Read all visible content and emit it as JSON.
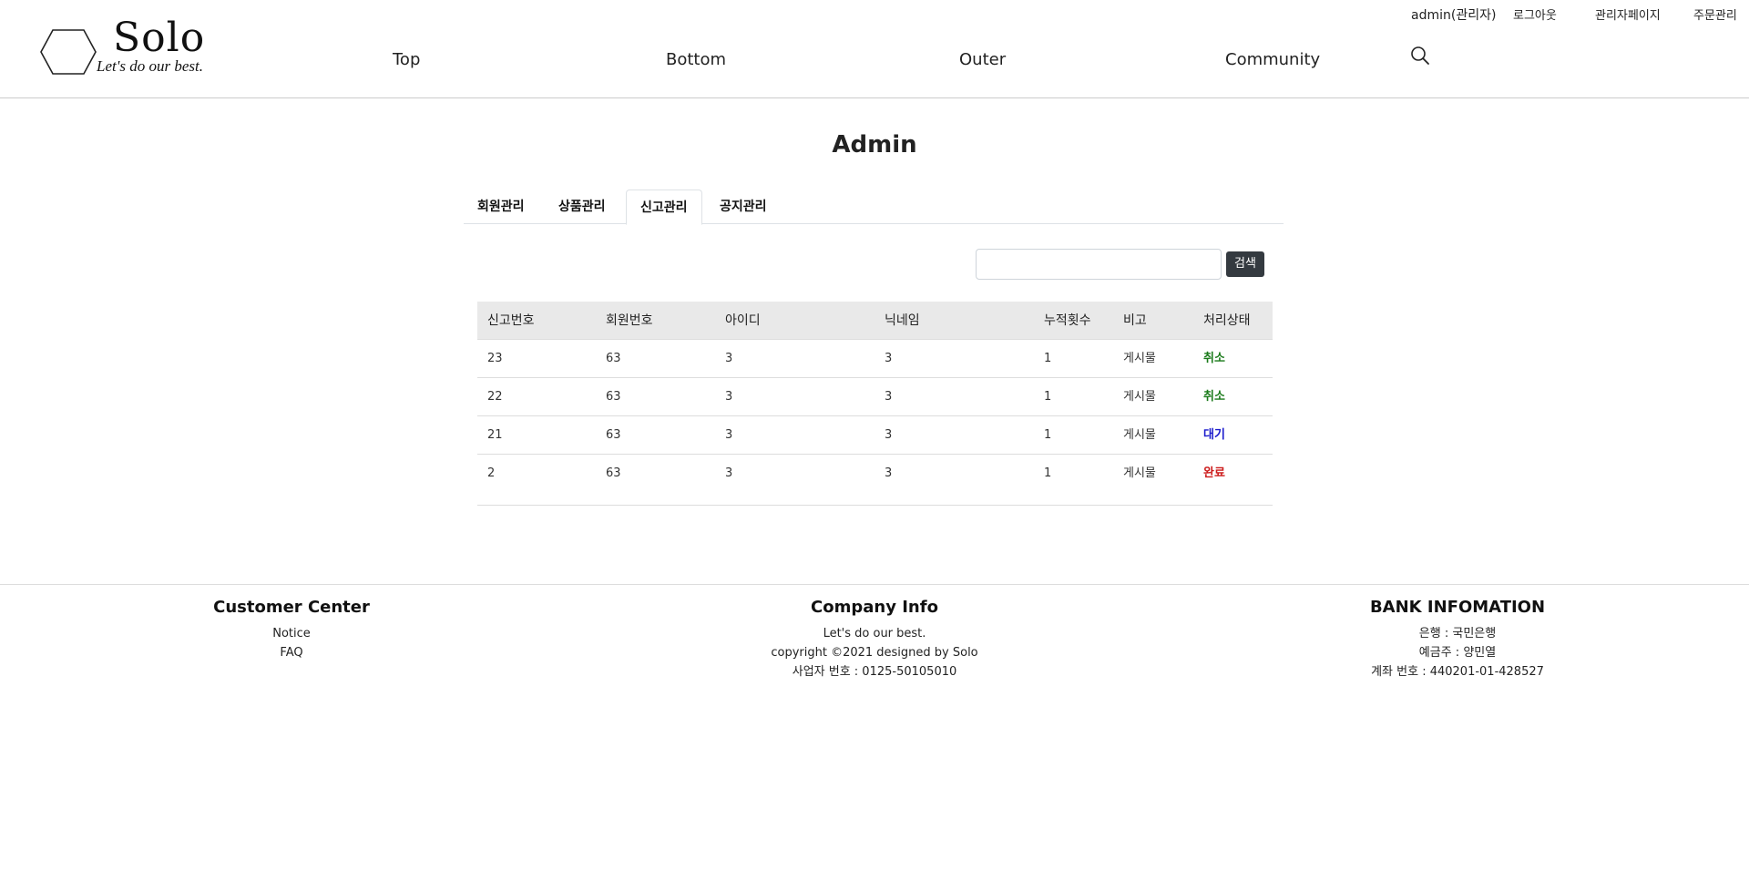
{
  "header": {
    "user": "admin(관리자)",
    "logout": "로그아웃",
    "admin_page": "관리자페이지",
    "order_manage": "주문관리",
    "logo_text": "Solo",
    "logo_slogan": "Let's do our best.",
    "nav": [
      "Top",
      "Bottom",
      "Outer",
      "Community"
    ],
    "search_icon": "search-icon"
  },
  "main": {
    "title": "Admin",
    "tabs": [
      {
        "label": "회원관리",
        "active": false
      },
      {
        "label": "상품관리",
        "active": false
      },
      {
        "label": "신고관리",
        "active": true
      },
      {
        "label": "공지관리",
        "active": false
      }
    ],
    "search": {
      "value": "",
      "button": "검색"
    },
    "table": {
      "headers": [
        "신고번호",
        "회원번호",
        "아이디",
        "닉네임",
        "누적횟수",
        "비고",
        "처리상태"
      ],
      "rows": [
        {
          "report_no": "23",
          "member_no": "63",
          "id": "3",
          "nickname": "3",
          "count": "1",
          "note": "게시물",
          "status": "취소",
          "status_color": "#1a7a1a"
        },
        {
          "report_no": "22",
          "member_no": "63",
          "id": "3",
          "nickname": "3",
          "count": "1",
          "note": "게시물",
          "status": "취소",
          "status_color": "#1a7a1a"
        },
        {
          "report_no": "21",
          "member_no": "63",
          "id": "3",
          "nickname": "3",
          "count": "1",
          "note": "게시물",
          "status": "대기",
          "status_color": "#1a1acc"
        },
        {
          "report_no": "2",
          "member_no": "63",
          "id": "3",
          "nickname": "3",
          "count": "1",
          "note": "게시물",
          "status": "완료",
          "status_color": "#cc1a1a"
        }
      ]
    }
  },
  "footer": {
    "customer_center": {
      "title": "Customer Center",
      "links": [
        "Notice",
        "FAQ"
      ]
    },
    "company_info": {
      "title": "Company Info",
      "lines": [
        "Let's do our best.",
        "copyright ©2021 designed by Solo",
        "사업자 번호 : 0125-50105010"
      ]
    },
    "bank_info": {
      "title": "BANK INFOMATION",
      "lines": [
        "은행 : 국민은행",
        "예금주 : 양민열",
        "계좌 번호 : 440201-01-428527"
      ]
    }
  }
}
